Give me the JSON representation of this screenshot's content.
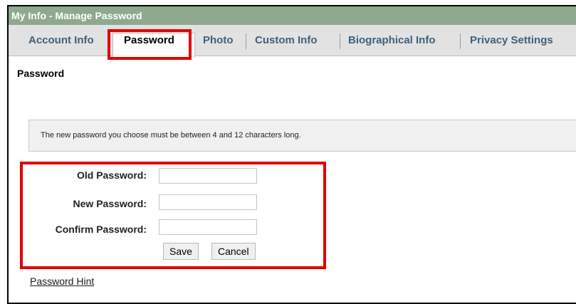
{
  "window": {
    "title": "My Info - Manage Password"
  },
  "tabs": [
    {
      "label": "Account Info"
    },
    {
      "label": "Password"
    },
    {
      "label": "Photo"
    },
    {
      "label": "Custom Info"
    },
    {
      "label": "Biographical Info"
    },
    {
      "label": "Privacy Settings"
    }
  ],
  "section": {
    "title": "Password"
  },
  "notice": {
    "text": "The new password you choose must be between 4 and 12 characters long."
  },
  "form": {
    "old_password_label": "Old Password:",
    "new_password_label": "New Password:",
    "confirm_password_label": "Confirm Password:",
    "old_password_value": "",
    "new_password_value": "",
    "confirm_password_value": "",
    "save_label": "Save",
    "cancel_label": "Cancel"
  },
  "links": {
    "password_hint": "Password Hint"
  },
  "colors": {
    "title_bar": "#8fa98f",
    "highlight": "#e00000",
    "tab_text": "#40607a"
  }
}
